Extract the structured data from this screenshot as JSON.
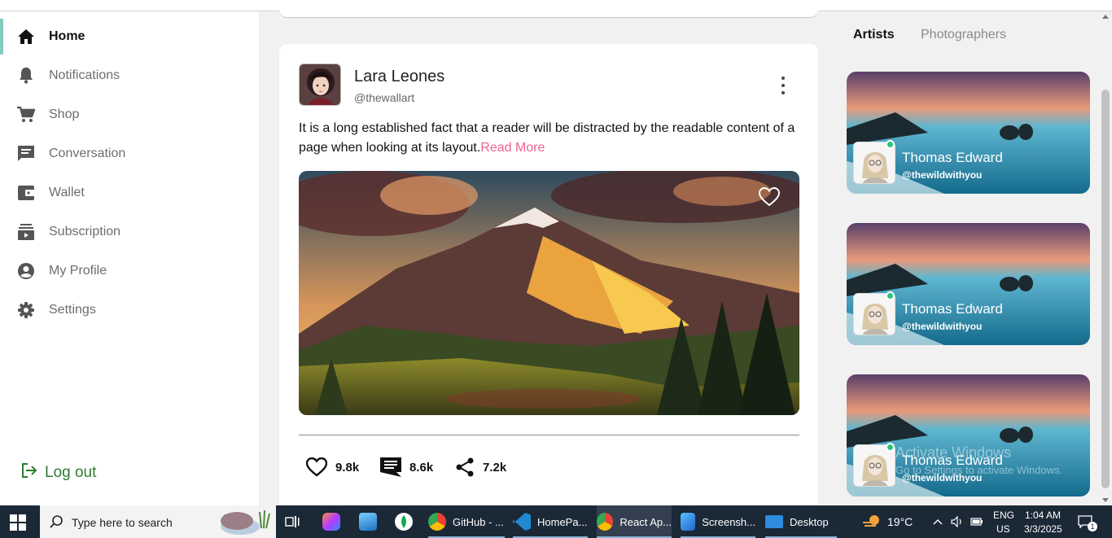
{
  "sidebar": {
    "items": [
      {
        "label": "Home",
        "icon": "home-icon",
        "active": true
      },
      {
        "label": "Notifications",
        "icon": "bell-icon"
      },
      {
        "label": "Shop",
        "icon": "cart-icon"
      },
      {
        "label": "Conversation",
        "icon": "chat-icon"
      },
      {
        "label": "Wallet",
        "icon": "wallet-icon"
      },
      {
        "label": "Subscription",
        "icon": "subscription-icon"
      },
      {
        "label": "My Profile",
        "icon": "profile-icon"
      },
      {
        "label": "Settings",
        "icon": "gear-icon"
      }
    ],
    "logout_label": "Log out"
  },
  "post": {
    "author_name": "Lara Leones",
    "author_handle": "@thewallart",
    "text": "It is a long established fact that a reader will be distracted by the readable content of a page when looking at its layout.",
    "read_more": "Read More",
    "likes": "9.8k",
    "comments": "8.6k",
    "shares": "7.2k"
  },
  "right_panel": {
    "tabs": [
      {
        "label": "Artists",
        "active": true
      },
      {
        "label": "Photographers",
        "active": false
      }
    ],
    "cards": [
      {
        "name": "Thomas Edward",
        "handle": "@thewildwithyou",
        "online": true
      },
      {
        "name": "Thomas Edward",
        "handle": "@thewildwithyou",
        "online": true
      },
      {
        "name": "Thomas Edward",
        "handle": "@thewildwithyou",
        "online": true
      }
    ],
    "watermark_title": "Activate Windows",
    "watermark_sub": "Go to Settings to activate Windows."
  },
  "taskbar": {
    "search_placeholder": "Type here to search",
    "apps": [
      {
        "label": "GitHub - ...",
        "icon": "chrome-icon"
      },
      {
        "label": "HomePa...",
        "icon": "vscode-icon"
      },
      {
        "label": "React Ap...",
        "icon": "chrome-icon"
      },
      {
        "label": "Screensh...",
        "icon": "photos-icon"
      },
      {
        "label": "Desktop",
        "icon": "folder-icon"
      }
    ],
    "weather": "19°C",
    "lang_1": "ENG",
    "lang_2": "US",
    "time": "1:04 AM",
    "date": "3/3/2025",
    "notifications_count": "1"
  },
  "colors": {
    "accent": "#86c9be",
    "read_more": "#f06292",
    "logout": "#2e7d32",
    "online": "#27c47a",
    "taskbar": "#1b2836"
  }
}
